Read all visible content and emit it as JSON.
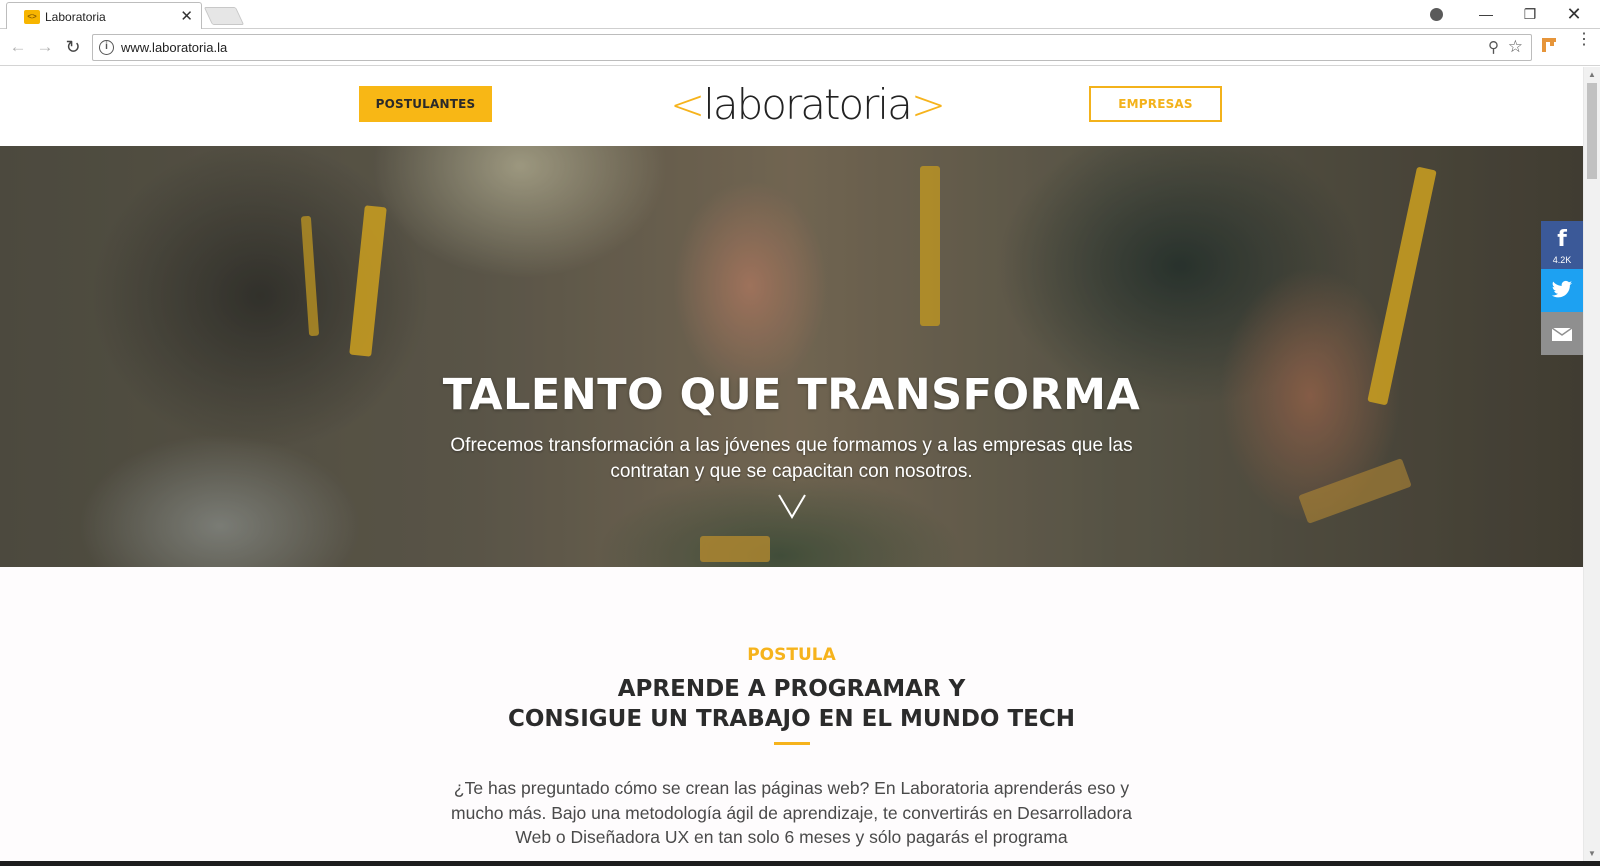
{
  "browser": {
    "tab_title": "Laboratoria",
    "tab_favicon": "laboratoria-favicon",
    "tab_close": "✕",
    "url": "www.laboratoria.la",
    "window_controls": {
      "minimize": "—",
      "restore": "❐",
      "close": "✕"
    }
  },
  "header": {
    "postulantes_label": "POSTULANTES",
    "logo_open": "<",
    "logo_text": "laboratoria",
    "logo_close": ">",
    "empresas_label": "EMPRESAS"
  },
  "hero": {
    "title": "TALENTO QUE TRANSFORMA",
    "subtitle": "Ofrecemos transformación a las jóvenes que formamos y a las empresas que las contratan y que se capacitan con nosotros.",
    "scroll_icon": "chevron-down-icon"
  },
  "share": {
    "facebook_icon": "f",
    "facebook_count": "4.2K",
    "twitter_icon": "twitter-bird-icon",
    "email_icon": "envelope-icon"
  },
  "section": {
    "kicker": "POSTULA",
    "headline_line1": "APRENDE A PROGRAMAR Y",
    "headline_line2": "CONSIGUE UN TRABAJO EN EL MUNDO TECH",
    "body": "¿Te has preguntado cómo se crean las páginas web? En Laboratoria aprenderás eso y mucho más. Bajo una metodología ágil de aprendizaje, te convertirás en Desarrolladora Web o Diseñadora UX en tan solo 6 meses y sólo pagarás el programa"
  },
  "colors": {
    "brand_yellow": "#f6b31c",
    "facebook": "#3b5998",
    "twitter": "#1da1f2",
    "email": "#8f8f8f"
  }
}
